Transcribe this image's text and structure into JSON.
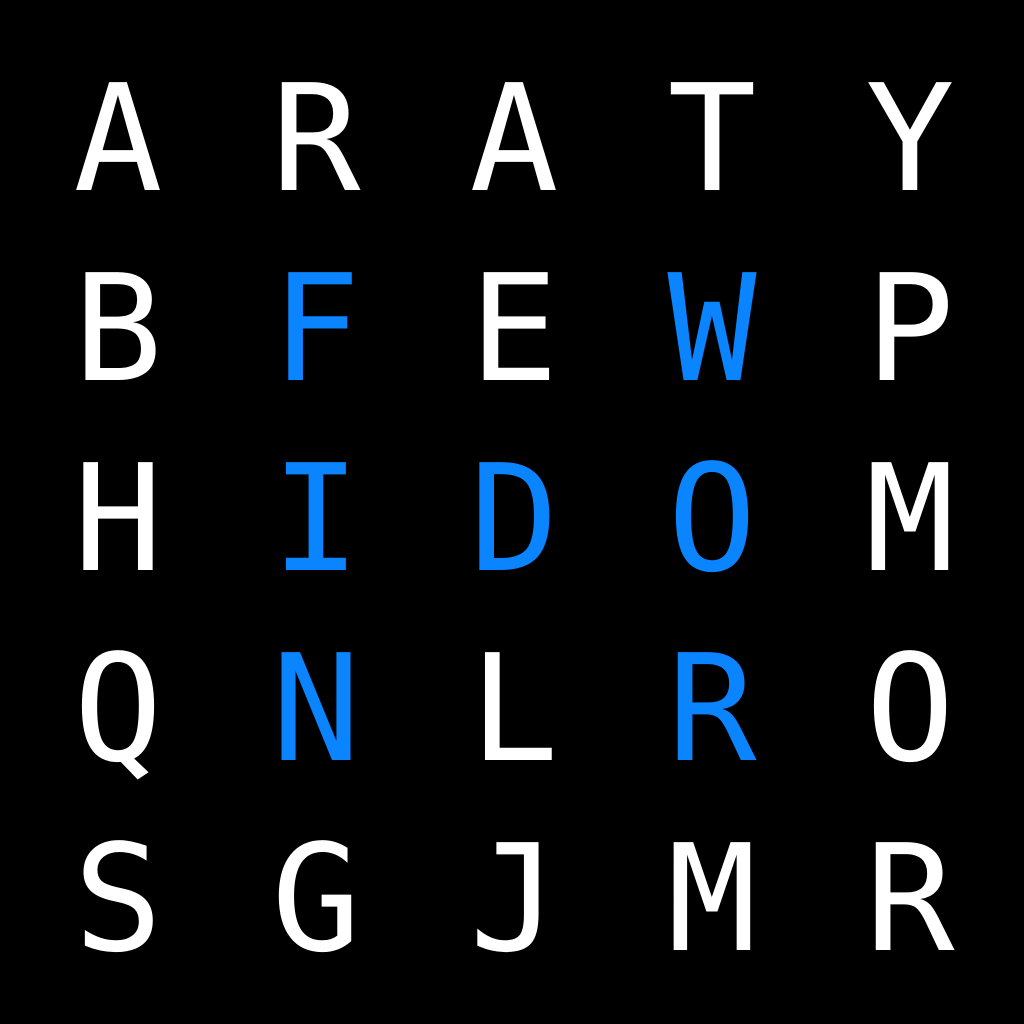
{
  "colors": {
    "background": "#000000",
    "letter": "#ffffff",
    "highlight": "#0a84ff"
  },
  "grid": {
    "rows": [
      {
        "cells": [
          {
            "letter": "A",
            "highlighted": false
          },
          {
            "letter": "R",
            "highlighted": false
          },
          {
            "letter": "A",
            "highlighted": false
          },
          {
            "letter": "T",
            "highlighted": false
          },
          {
            "letter": "Y",
            "highlighted": false
          }
        ]
      },
      {
        "cells": [
          {
            "letter": "B",
            "highlighted": false
          },
          {
            "letter": "F",
            "highlighted": true
          },
          {
            "letter": "E",
            "highlighted": false
          },
          {
            "letter": "W",
            "highlighted": true
          },
          {
            "letter": "P",
            "highlighted": false
          }
        ]
      },
      {
        "cells": [
          {
            "letter": "H",
            "highlighted": false
          },
          {
            "letter": "I",
            "highlighted": true
          },
          {
            "letter": "D",
            "highlighted": true
          },
          {
            "letter": "O",
            "highlighted": true
          },
          {
            "letter": "M",
            "highlighted": false
          }
        ]
      },
      {
        "cells": [
          {
            "letter": "Q",
            "highlighted": false
          },
          {
            "letter": "N",
            "highlighted": true
          },
          {
            "letter": "L",
            "highlighted": false
          },
          {
            "letter": "R",
            "highlighted": true
          },
          {
            "letter": "O",
            "highlighted": false
          }
        ]
      },
      {
        "cells": [
          {
            "letter": "S",
            "highlighted": false
          },
          {
            "letter": "G",
            "highlighted": false
          },
          {
            "letter": "J",
            "highlighted": false
          },
          {
            "letter": "M",
            "highlighted": false
          },
          {
            "letter": "R",
            "highlighted": false
          }
        ]
      }
    ]
  }
}
